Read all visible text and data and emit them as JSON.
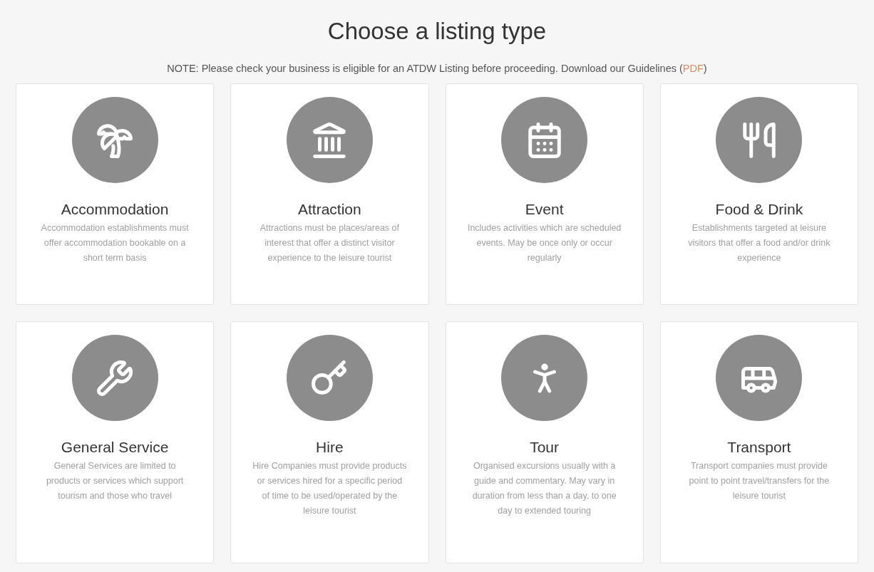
{
  "title": "Choose a listing type",
  "note": {
    "text": "NOTE: Please check your business is eligible for an ATDW Listing before proceeding. Download our Guidelines (",
    "link": "PDF",
    "after": ")"
  },
  "listing_types": [
    {
      "name": "Accommodation",
      "description": "Accommodation establishments must offer accommodation bookable on a short term basis"
    },
    {
      "name": "Attraction",
      "description": "Attractions must be places/areas of interest that offer a distinct visitor experience to the leisure tourist"
    },
    {
      "name": "Event",
      "description": "Includes activities which are scheduled events. May be once only or occur regularly"
    },
    {
      "name": "Food & Drink",
      "description": "Establishments targeted at leisure visitors that offer a food and/or drink experience"
    },
    {
      "name": "General Service",
      "description": "General Services are limited to products or services which support tourism and those who travel"
    },
    {
      "name": "Hire",
      "description": "Hire Companies must provide products or services hired for a specific period of time to be used/operated by the leisure tourist"
    },
    {
      "name": "Tour",
      "description": "Organised excursions usually with a guide and commentary. May vary in duration from less than a day, to one day to extended touring"
    },
    {
      "name": "Transport",
      "description": "Transport companies must provide point to point travel/transfers for the leisure tourist"
    }
  ]
}
